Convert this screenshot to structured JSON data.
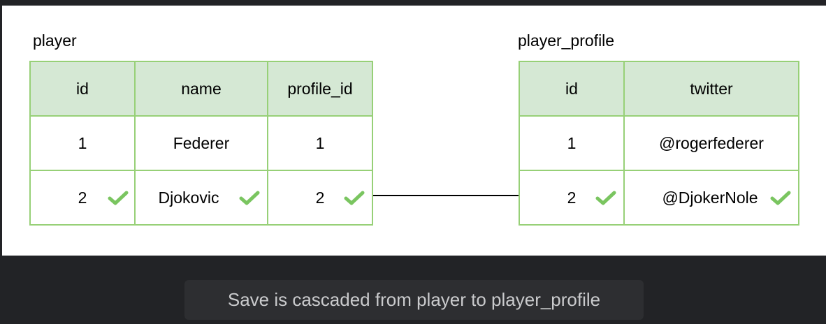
{
  "player_table": {
    "title": "player",
    "columns": [
      "id",
      "name",
      "profile_id"
    ],
    "rows": [
      {
        "id": "1",
        "name": "Federer",
        "profile_id": "1",
        "checked": false
      },
      {
        "id": "2",
        "name": "Djokovic",
        "profile_id": "2",
        "checked": true
      }
    ]
  },
  "profile_table": {
    "title": "player_profile",
    "columns": [
      "id",
      "twitter"
    ],
    "rows": [
      {
        "id": "1",
        "twitter": "@rogerfederer",
        "checked": false
      },
      {
        "id": "2",
        "twitter": "@DjokerNole",
        "checked": true
      }
    ]
  },
  "caption": "Save is cascaded from player to player_profile",
  "colors": {
    "header_fill": "#d5e8d4",
    "border": "#97d077",
    "check": "#7ac560",
    "background": "#222326"
  },
  "icons": {
    "row_mark": "checkmark-icon"
  }
}
